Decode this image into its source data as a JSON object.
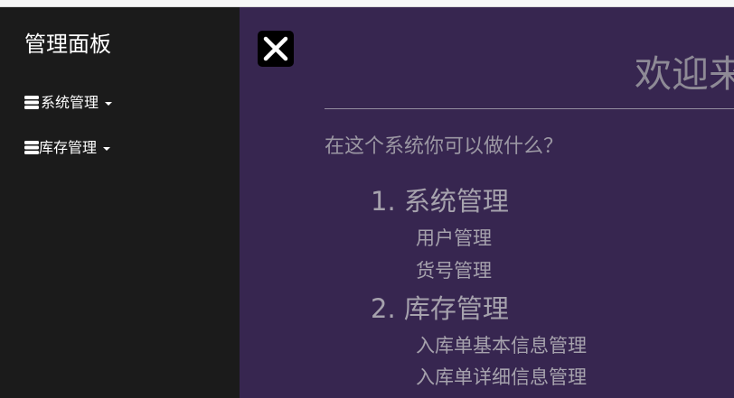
{
  "sidebar": {
    "brand": "管理面板",
    "items": [
      {
        "icon": "database-icon",
        "label": "系统管理"
      },
      {
        "icon": "database-icon",
        "label": "库存管理"
      }
    ]
  },
  "main": {
    "toggle_icon": "close-icon",
    "welcome": "欢迎来",
    "question": "在这个系统你可以做什么？",
    "sections": [
      {
        "title": "1. 系统管理",
        "items": [
          "用户管理",
          "货号管理"
        ]
      },
      {
        "title": "2. 库存管理",
        "items": [
          "入库单基本信息管理",
          "入库单详细信息管理"
        ]
      }
    ]
  },
  "colors": {
    "sidebar_bg": "#1b1b1b",
    "main_bg": "#372650",
    "text_muted": "#a6a2ad"
  }
}
